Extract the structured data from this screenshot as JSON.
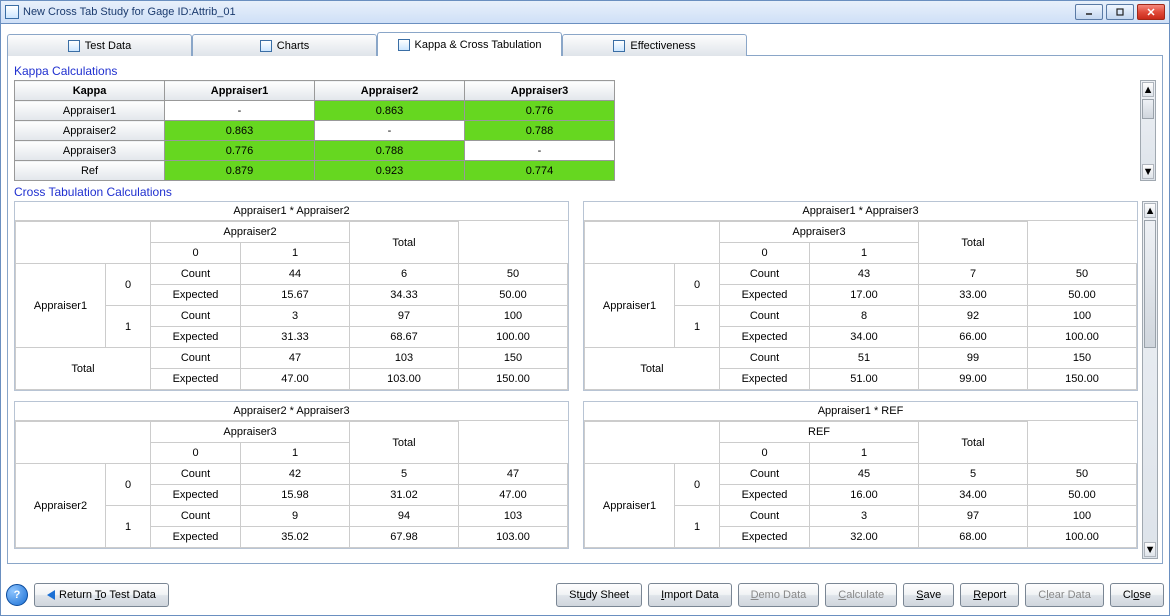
{
  "window": {
    "title": "New Cross Tab Study for Gage ID:Attrib_01"
  },
  "tabs": [
    {
      "label": "Test Data"
    },
    {
      "label": "Charts"
    },
    {
      "label": "Kappa & Cross Tabulation",
      "active": true
    },
    {
      "label": "Effectiveness"
    }
  ],
  "section": {
    "kappa_title": "Kappa Calculations",
    "xtab_title": "Cross Tabulation Calculations"
  },
  "kappa": {
    "header_row": [
      "Kappa",
      "Appraiser1",
      "Appraiser2",
      "Appraiser3"
    ],
    "rows": [
      {
        "label": "Appraiser1",
        "cells": [
          "-",
          "0.863",
          "0.776"
        ],
        "hi": [
          false,
          true,
          true
        ]
      },
      {
        "label": "Appraiser2",
        "cells": [
          "0.863",
          "-",
          "0.788"
        ],
        "hi": [
          true,
          false,
          true
        ]
      },
      {
        "label": "Appraiser3",
        "cells": [
          "0.776",
          "0.788",
          "-"
        ],
        "hi": [
          true,
          true,
          false
        ]
      },
      {
        "label": "Ref",
        "cells": [
          "0.879",
          "0.923",
          "0.774"
        ],
        "hi": [
          true,
          true,
          true
        ]
      }
    ]
  },
  "crosstabs": [
    {
      "title": "Appraiser1 * Appraiser2",
      "row_appraiser": "Appraiser1",
      "col_appraiser": "Appraiser2",
      "col_cats": [
        "0",
        "1"
      ],
      "row_cats": [
        "0",
        "1"
      ],
      "total_label": "Total",
      "count_label": "Count",
      "expected_label": "Expected",
      "body": [
        {
          "cat": "0",
          "count": [
            "44",
            "6",
            "50"
          ],
          "expected": [
            "15.67",
            "34.33",
            "50.00"
          ]
        },
        {
          "cat": "1",
          "count": [
            "3",
            "97",
            "100"
          ],
          "expected": [
            "31.33",
            "68.67",
            "100.00"
          ]
        }
      ],
      "totals": {
        "count": [
          "47",
          "103",
          "150"
        ],
        "expected": [
          "47.00",
          "103.00",
          "150.00"
        ]
      }
    },
    {
      "title": "Appraiser1 * Appraiser3",
      "row_appraiser": "Appraiser1",
      "col_appraiser": "Appraiser3",
      "col_cats": [
        "0",
        "1"
      ],
      "row_cats": [
        "0",
        "1"
      ],
      "total_label": "Total",
      "count_label": "Count",
      "expected_label": "Expected",
      "body": [
        {
          "cat": "0",
          "count": [
            "43",
            "7",
            "50"
          ],
          "expected": [
            "17.00",
            "33.00",
            "50.00"
          ]
        },
        {
          "cat": "1",
          "count": [
            "8",
            "92",
            "100"
          ],
          "expected": [
            "34.00",
            "66.00",
            "100.00"
          ]
        }
      ],
      "totals": {
        "count": [
          "51",
          "99",
          "150"
        ],
        "expected": [
          "51.00",
          "99.00",
          "150.00"
        ]
      }
    },
    {
      "title": "Appraiser2 * Appraiser3",
      "row_appraiser": "Appraiser2",
      "col_appraiser": "Appraiser3",
      "col_cats": [
        "0",
        "1"
      ],
      "row_cats": [
        "0",
        "1"
      ],
      "total_label": "Total",
      "count_label": "Count",
      "expected_label": "Expected",
      "body": [
        {
          "cat": "0",
          "count": [
            "42",
            "5",
            "47"
          ],
          "expected": [
            "15.98",
            "31.02",
            "47.00"
          ]
        },
        {
          "cat": "1",
          "count": [
            "9",
            "94",
            "103"
          ],
          "expected": [
            "35.02",
            "67.98",
            "103.00"
          ]
        }
      ],
      "totals": null
    },
    {
      "title": "Appraiser1 * REF",
      "row_appraiser": "Appraiser1",
      "col_appraiser": "REF",
      "col_cats": [
        "0",
        "1"
      ],
      "row_cats": [
        "0",
        "1"
      ],
      "total_label": "Total",
      "count_label": "Count",
      "expected_label": "Expected",
      "body": [
        {
          "cat": "0",
          "count": [
            "45",
            "5",
            "50"
          ],
          "expected": [
            "16.00",
            "34.00",
            "50.00"
          ]
        },
        {
          "cat": "1",
          "count": [
            "3",
            "97",
            "100"
          ],
          "expected": [
            "32.00",
            "68.00",
            "100.00"
          ]
        }
      ],
      "totals": null
    }
  ],
  "buttons": {
    "return": "Return To Test Data",
    "study": "Study Sheet",
    "import": "Import Data",
    "demo": "Demo Data",
    "calc": "Calculate",
    "save": "Save",
    "report": "Report",
    "clear": "Clear Data",
    "close": "Close"
  }
}
